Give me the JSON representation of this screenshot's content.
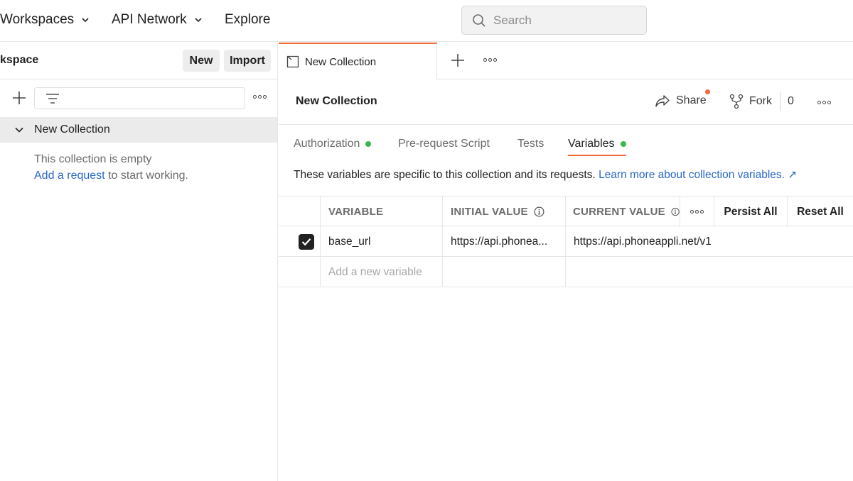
{
  "topnav": {
    "workspaces": "Workspaces",
    "api_network": "API Network",
    "explore": "Explore",
    "search_placeholder": "Search"
  },
  "sidebar": {
    "workspace_title": "kspace",
    "new_label": "New",
    "import_label": "Import",
    "collection_name": "New Collection",
    "empty_line1": "This collection is empty",
    "add_request_link": "Add a request",
    "empty_line2_rest": " to start working."
  },
  "tabs": {
    "active_tab_label": "New Collection"
  },
  "collection": {
    "title": "New Collection",
    "share_label": "Share",
    "fork_label": "Fork",
    "fork_count": "0",
    "subtabs": [
      {
        "label": "Authorization"
      },
      {
        "label": "Pre-request Script"
      },
      {
        "label": "Tests"
      },
      {
        "label": "Variables"
      }
    ],
    "description": "These variables are specific to this collection and its requests.",
    "learn_more_link": "Learn more about collection variables. ↗"
  },
  "variables_table": {
    "headers": {
      "variable": "VARIABLE",
      "initial_value": "INITIAL VALUE",
      "current_value": "CURRENT VALUE",
      "persist_all": "Persist All",
      "reset_all": "Reset All"
    },
    "rows": [
      {
        "name": "base_url",
        "initial": "https://api.phonea...",
        "current": "https://api.phoneappli.net/v1"
      }
    ],
    "add_placeholder": "Add a new variable"
  },
  "colors": {
    "accent": "#f26b3a",
    "status_green": "#3fb54e",
    "link_blue": "#2968c8"
  }
}
